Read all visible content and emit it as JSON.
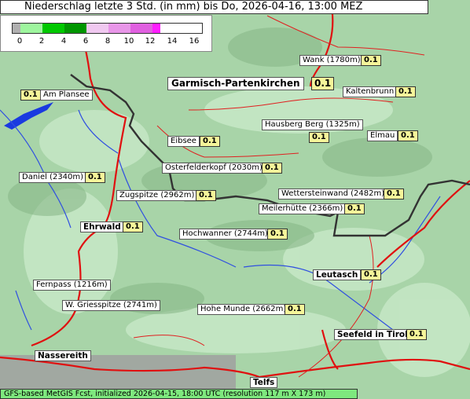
{
  "title": "Niederschlag letzte 3 Std. (in mm) bis Do, 2026-04-16, 13:00 MEZ",
  "legend": {
    "ticks": [
      "0",
      "2",
      "4",
      "6",
      "8",
      "10",
      "12",
      "14",
      "16"
    ],
    "colors": [
      "#b0b0b0",
      "#9ef59e",
      "#00c800",
      "#009600",
      "#f0c8f0",
      "#e896e8",
      "#e060e0",
      "#ff1eff"
    ]
  },
  "places": [
    {
      "name": "Garmisch-Partenkirchen",
      "value": "0.1"
    },
    {
      "name": "Wank (1780m)",
      "value": "0.1"
    },
    {
      "name": "Kaltenbrunn",
      "value": "0.1"
    },
    {
      "name": "Am Plansee",
      "value": "0.1"
    },
    {
      "name": "Hausberg Berg (1325m)",
      "value": "0.1"
    },
    {
      "name": "Eibsee",
      "value": "0.1"
    },
    {
      "name": "Elmau",
      "value": "0.1"
    },
    {
      "name": "Osterfelderkopf (2030m)",
      "value": "0.1"
    },
    {
      "name": "Daniel (2340m)",
      "value": "0.1"
    },
    {
      "name": "Zugspitze (2962m)",
      "value": "0.1"
    },
    {
      "name": "Wettersteinwand (2482m)",
      "value": "0.1"
    },
    {
      "name": "Meilerhütte (2366m)",
      "value": "0.1"
    },
    {
      "name": "Ehrwald",
      "value": "0.1"
    },
    {
      "name": "Hochwanner (2744m)",
      "value": "0.1"
    },
    {
      "name": "Leutasch",
      "value": "0.1"
    },
    {
      "name": "Fernpass (1216m)",
      "value": ""
    },
    {
      "name": "W. Griesspitze (2741m)",
      "value": ""
    },
    {
      "name": "Hohe Munde (2662m)",
      "value": "0.1"
    },
    {
      "name": "Seefeld in Tirol",
      "value": "0.1"
    },
    {
      "name": "Nassereith",
      "value": ""
    },
    {
      "name": "Telfs",
      "value": ""
    }
  ],
  "footer": "GFS-based MetGIS Fcst, initialized 2026-04-15, 18:00 UTC  (resolution 117 m X 173 m)"
}
